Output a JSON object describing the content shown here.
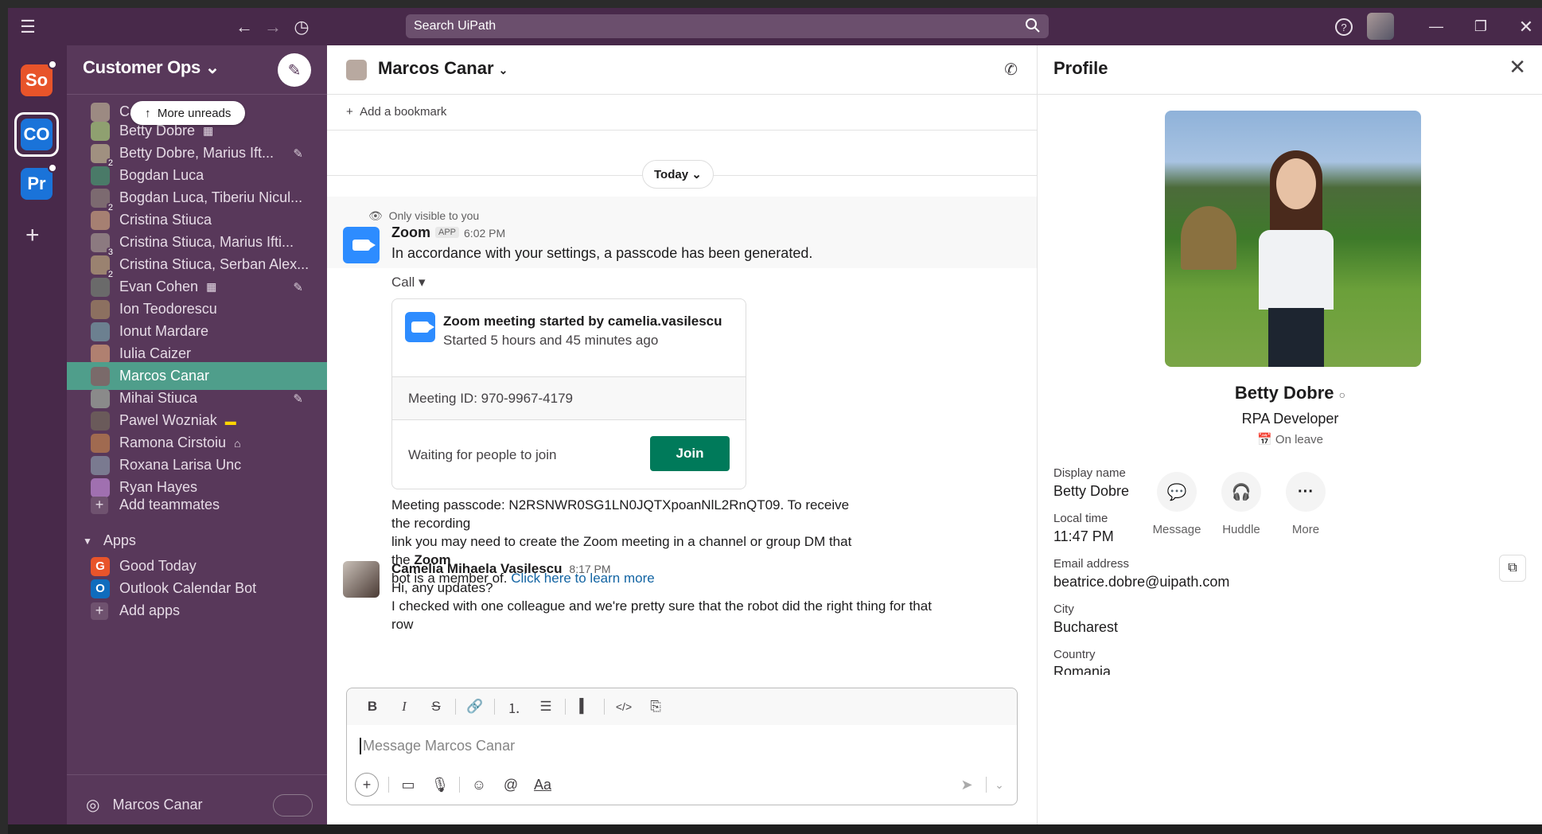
{
  "topbar": {
    "search_placeholder": "Search UiPath"
  },
  "workspaces": [
    {
      "abbr": "So",
      "color": "#e8542a"
    },
    {
      "abbr": "CO",
      "color": "#1a73d9"
    },
    {
      "abbr": "Pr",
      "color": "#1a73d9"
    }
  ],
  "sidebar": {
    "workspace_name": "Customer Ops",
    "more_unreads": "More unreads",
    "dms": [
      {
        "label": "Ca... ...escu",
        "count": ""
      },
      {
        "label": "Betty Dobre",
        "status_icon": "on-leave-icon"
      },
      {
        "label": "Betty Dobre, Marius Ift...",
        "count": "2",
        "edit": true
      },
      {
        "label": "Bogdan Luca"
      },
      {
        "label": "Bogdan Luca, Tiberiu Nicul...",
        "count": "2"
      },
      {
        "label": "Cristina Stiuca"
      },
      {
        "label": "Cristina Stiuca, Marius Ifti...",
        "count": "3"
      },
      {
        "label": "Cristina Stiuca, Serban Alex...",
        "count": "2"
      },
      {
        "label": "Evan Cohen",
        "status_icon": "calendar-icon",
        "edit": true
      },
      {
        "label": "Ion Teodorescu"
      },
      {
        "label": "Ionut Mardare"
      },
      {
        "label": "Iulia Caizer"
      },
      {
        "label": "Marcos Canar",
        "active": true
      },
      {
        "label": "Mihai Stiuca",
        "edit": true
      },
      {
        "label": "Pawel Wozniak",
        "status_icon": "flag-icon"
      },
      {
        "label": "Ramona Cirstoiu",
        "status_icon": "house-icon"
      },
      {
        "label": "Roxana Larisa Unc"
      },
      {
        "label": "Ryan Hayes"
      }
    ],
    "add_teammates": "Add teammates",
    "apps_section": "Apps",
    "apps": [
      {
        "label": "Good Today",
        "icon_letter": "G",
        "color": "#e8542a"
      },
      {
        "label": "Outlook Calendar Bot",
        "icon_letter": "O",
        "color": "#0f6cbd"
      }
    ],
    "add_apps": "Add apps",
    "footer_name": "Marcos Canar"
  },
  "channel": {
    "title": "Marcos Canar",
    "add_bookmark": "Add a bookmark",
    "date_divider": "Today",
    "only_visible": "Only visible to you",
    "zoom_msg": {
      "name": "Zoom",
      "tag": "APP",
      "time": "6:02 PM",
      "text": "In accordance with your settings, a passcode has been generated.",
      "call_label": "Call",
      "card_title": "Zoom meeting started by camelia.vasilescu",
      "card_subtitle": "Started 5 hours and 45 minutes ago",
      "meeting_id": "Meeting ID: 970-9967-4179",
      "waiting": "Waiting for people to join",
      "join": "Join",
      "passcode_line1": "Meeting passcode: N2RSNWR0SG1LN0JQTXpoanNlL2RnQT09. To receive the recording",
      "passcode_line2a": "link you may need to create the Zoom meeting in a channel or group DM that the ",
      "passcode_line2b": "Zoom",
      "passcode_line3a": "bot is a member of. ",
      "passcode_link": "Click here to learn more"
    },
    "camelia_msg": {
      "name": "Camelia Mihaela Vasilescu",
      "time": "8:17 PM",
      "line1": "Hi, any updates?",
      "line2": "I checked with one colleague and we're pretty sure that the robot did the right thing for that",
      "line3": "row"
    },
    "composer_placeholder": "Message Marcos Canar"
  },
  "profile": {
    "title": "Profile",
    "name": "Betty Dobre",
    "role": "RPA Developer",
    "status": "On leave",
    "actions": [
      "Message",
      "Huddle",
      "More"
    ],
    "fields": [
      {
        "label": "Display name",
        "value": "Betty Dobre"
      },
      {
        "label": "Local time",
        "value": "11:47 PM"
      },
      {
        "label": "Email address",
        "value": "beatrice.dobre@uipath.com",
        "link": true
      },
      {
        "label": "City",
        "value": "Bucharest"
      },
      {
        "label": "Country",
        "value": "Romania"
      }
    ]
  }
}
